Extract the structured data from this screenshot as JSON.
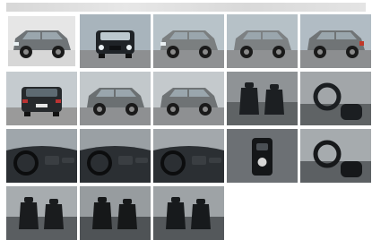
{
  "gallery": {
    "thumbnails": [
      {
        "view": "front-left",
        "bg": "#e6e6e6",
        "ground": "#d7d7d7",
        "car": "#6f7477",
        "selected": true
      },
      {
        "view": "front",
        "bg": "#a8b4bc",
        "ground": "#8d8f91",
        "car": "#1f2327"
      },
      {
        "view": "front-left",
        "bg": "#b8c3c9",
        "ground": "#8f9193",
        "car": "#7b7f80"
      },
      {
        "view": "left",
        "bg": "#b6c1c7",
        "ground": "#8f9193",
        "car": "#7d8183"
      },
      {
        "view": "rear-left",
        "bg": "#b1bcc4",
        "ground": "#8c8e90",
        "car": "#707476"
      },
      {
        "view": "rear",
        "bg": "#c5cbcf",
        "ground": "#9a9a9a",
        "car": "#26292c"
      },
      {
        "view": "left",
        "bg": "#c2c8cb",
        "ground": "#8e9092",
        "car": "#6b7072"
      },
      {
        "view": "left",
        "bg": "#c4c9cc",
        "ground": "#8e9092",
        "car": "#6f7375"
      },
      {
        "view": "seats",
        "bg": "#8f9396",
        "ground": "#5f6365",
        "car": "#1c1f22"
      },
      {
        "view": "cabin",
        "bg": "#a2a6a9",
        "ground": "#5f6365",
        "car": "#1b1e21"
      },
      {
        "view": "dashboard",
        "bg": "#9fa6ab",
        "ground": "#2b2f33",
        "car": "#151719"
      },
      {
        "view": "dashboard",
        "bg": "#9aa0a4",
        "ground": "#2b2f33",
        "car": "#151719"
      },
      {
        "view": "dashboard",
        "bg": "#a3a8ac",
        "ground": "#2b2f33",
        "car": "#151719"
      },
      {
        "view": "console",
        "bg": "#6c7074",
        "ground": "#2a2d30",
        "car": "#141618"
      },
      {
        "view": "cabin",
        "bg": "#a6abae",
        "ground": "#5c6063",
        "car": "#16181a"
      },
      {
        "view": "seats",
        "bg": "#a7acaf",
        "ground": "#5a5e61",
        "car": "#1a1c1e"
      },
      {
        "view": "seats",
        "bg": "#979c9f",
        "ground": "#4f5356",
        "car": "#161819"
      },
      {
        "view": "seats",
        "bg": "#9ea3a6",
        "ground": "#54585b",
        "car": "#171a1c"
      }
    ]
  }
}
